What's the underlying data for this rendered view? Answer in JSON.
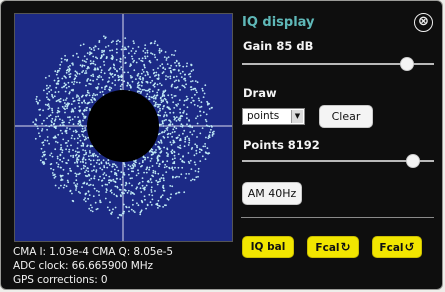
{
  "panel": {
    "title": "IQ display",
    "close_icon": "⊗"
  },
  "gain": {
    "label": "Gain 85 dB",
    "slider_fraction": 0.86
  },
  "draw": {
    "label": "Draw",
    "mode_value": "points",
    "dropdown_arrow": "▼",
    "clear_label": "Clear"
  },
  "points": {
    "label": "Points 8192",
    "slider_fraction": 0.89
  },
  "am_button_label": "AM 40Hz",
  "buttons": {
    "iq_bal": "IQ bal",
    "fcal_plus_text": "Fcal",
    "fcal_plus_icon": "↻",
    "fcal_minus_text": "Fcal",
    "fcal_minus_icon": "↺"
  },
  "status": {
    "cma": "CMA I: 1.03e-4   CMA Q: 8.05e-5",
    "adc_clock": "ADC clock: 66.665900 MHz",
    "gps_corrections": "GPS corrections: 0"
  },
  "colors": {
    "plot_background": "#1c2a86",
    "points": "#bfeaf5",
    "crosshair": "#dcdcf0",
    "title": "#5fb8b8",
    "button_yellow": "#f2e600"
  },
  "icons": [
    "close-icon",
    "dropdown-arrow-icon",
    "rotate-cw-icon",
    "rotate-ccw-icon"
  ]
}
